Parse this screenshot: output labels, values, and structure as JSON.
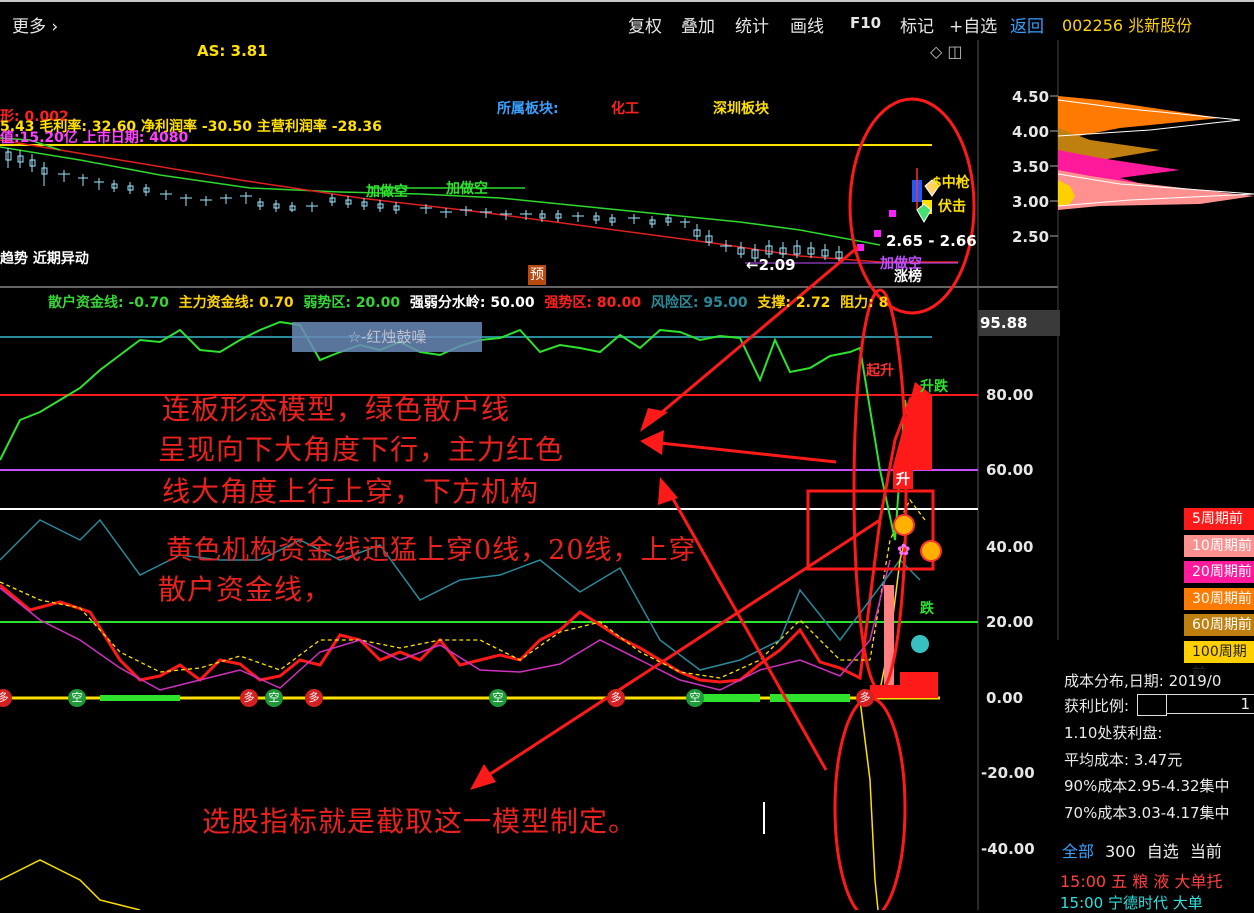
{
  "topbar": {
    "more_label": "更多",
    "menu": [
      "复权",
      "叠加",
      "统计",
      "画线",
      "F10",
      "标记",
      "+自选"
    ],
    "back_label": "返回",
    "stock_label": "002256 兆新股份"
  },
  "main_chart": {
    "as_label": "AS: 3.81",
    "sector_label": "所属板块:",
    "sector_value": "化工",
    "sector_region": "深圳板块",
    "info_line1": "形: 0.002",
    "info_line2": "5.43 毛利率: 32.60 净利润率 -30.50 主营利润率 -28.36",
    "info_line3": "值:15.20亿 上市日期: 4080",
    "add_short_1": "加做空",
    "add_short_2": "加做空",
    "add_short_3": "加做空",
    "low_price": "←2.09",
    "range_label": "2.65 - 2.66",
    "trend_label": "趋势 近期异动",
    "yu_label": "预",
    "rise_rank": "涨榜",
    "signal_zhongqiang": "$中枪",
    "signal_fuji": "伏击",
    "price_axis": [
      "4.50",
      "4.00",
      "3.50",
      "3.00",
      "2.50"
    ]
  },
  "indicator": {
    "legend": [
      {
        "text": "散户资金线: -0.70",
        "color": "#37d437"
      },
      {
        "text": "主力资金线: 0.70",
        "color": "#ffd400"
      },
      {
        "text": "弱势区: 20.00",
        "color": "#37d437"
      },
      {
        "text": "强弱分水岭: 50.00",
        "color": "#ffffff"
      },
      {
        "text": "强势区: 80.00",
        "color": "#ff2020"
      },
      {
        "text": "风险区: 95.00",
        "color": "#2a8a9a"
      },
      {
        "text": "支撑: 2.72",
        "color": "#ffd400"
      },
      {
        "text": "阻力: 8",
        "color": "#ffd400"
      }
    ],
    "top_value": "95.88",
    "popup_label": "☆-红烛鼓噪",
    "qisheng": "起升",
    "kaidie": "升跌",
    "sheng": "升",
    "jin": "跌",
    "axis": [
      "80.00",
      "60.00",
      "40.00",
      "20.00",
      "0.00",
      "-20.00",
      "-40.00"
    ],
    "markers": [
      {
        "label": "多",
        "color": "#d42020"
      },
      {
        "label": "空",
        "color": "#1e9a3a"
      },
      {
        "label": "多",
        "color": "#d42020"
      },
      {
        "label": "空",
        "color": "#1e9a3a"
      },
      {
        "label": "多",
        "color": "#d42020"
      },
      {
        "label": "空",
        "color": "#1e9a3a"
      },
      {
        "label": "多",
        "color": "#d42020"
      },
      {
        "label": "空",
        "color": "#1e9a3a"
      },
      {
        "label": "多",
        "color": "#d42020"
      }
    ]
  },
  "annotation": {
    "line1": "连板形态模型，绿色散户线",
    "line2": "呈现向下大角度下行，主力红色",
    "line3": "线大角度上行上穿，下方机构",
    "line4": "黄色机构资金线迅猛上穿0线，20线，上穿",
    "line5": "散户资金线，",
    "conclusion": "选股指标就是截取这一模型制定。"
  },
  "right_panel": {
    "periods": [
      {
        "label": "5周期前",
        "color": "#ff1a1a"
      },
      {
        "label": "10周期前",
        "color": "#ff9090"
      },
      {
        "label": "20周期前",
        "color": "#ff1a9c"
      },
      {
        "label": "30周期前",
        "color": "#ff7a00"
      },
      {
        "label": "60周期前",
        "color": "#c08010"
      },
      {
        "label": "100周期前",
        "color": "#ffd000"
      }
    ],
    "cost_date": "成本分布,日期: 2019/0",
    "profit_ratio": "获利比例:",
    "profit_value": "1",
    "profit_line": "1.10处获利盘:",
    "avg_cost": "平均成本: 3.47元",
    "cost90": "90%成本2.95-4.32集中",
    "cost70": "70%成本3.03-4.17集中",
    "tabs": [
      "全部",
      "300",
      "自选",
      "当前"
    ],
    "tick_row": "15:00 五 粮 液    大单托",
    "tick_row2": "15:00 宁德时代   大单"
  },
  "colors": {
    "red": "#ff1a1a",
    "yellow": "#ffe000",
    "green": "#2ee22e",
    "cyan": "#2a8a9a"
  }
}
